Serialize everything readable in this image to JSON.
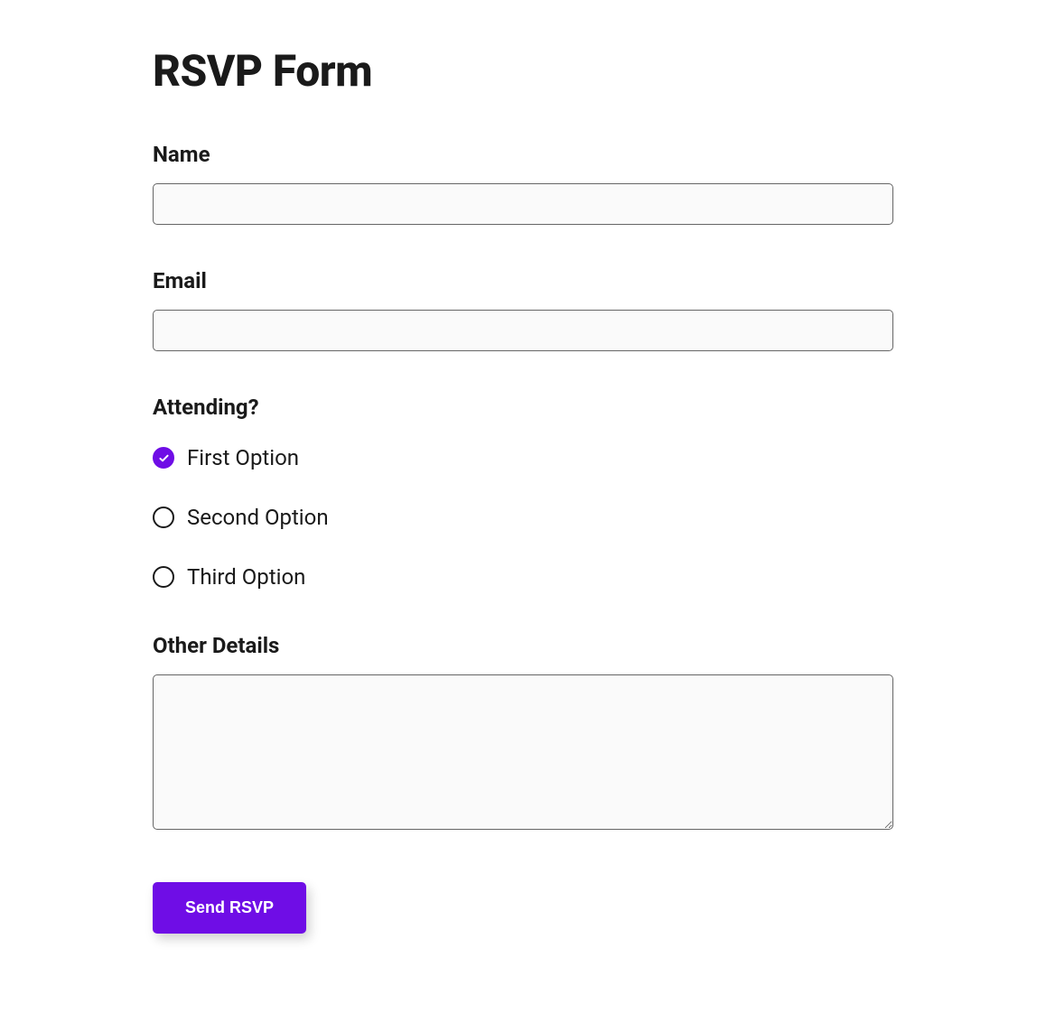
{
  "form": {
    "title": "RSVP Form",
    "fields": {
      "name": {
        "label": "Name",
        "value": ""
      },
      "email": {
        "label": "Email",
        "value": ""
      },
      "attending": {
        "label": "Attending?",
        "options": [
          {
            "label": "First Option",
            "selected": true
          },
          {
            "label": "Second Option",
            "selected": false
          },
          {
            "label": "Third Option",
            "selected": false
          }
        ]
      },
      "details": {
        "label": "Other Details",
        "value": ""
      }
    },
    "submit_label": "Send RSVP"
  },
  "colors": {
    "accent": "#6f0de6"
  }
}
